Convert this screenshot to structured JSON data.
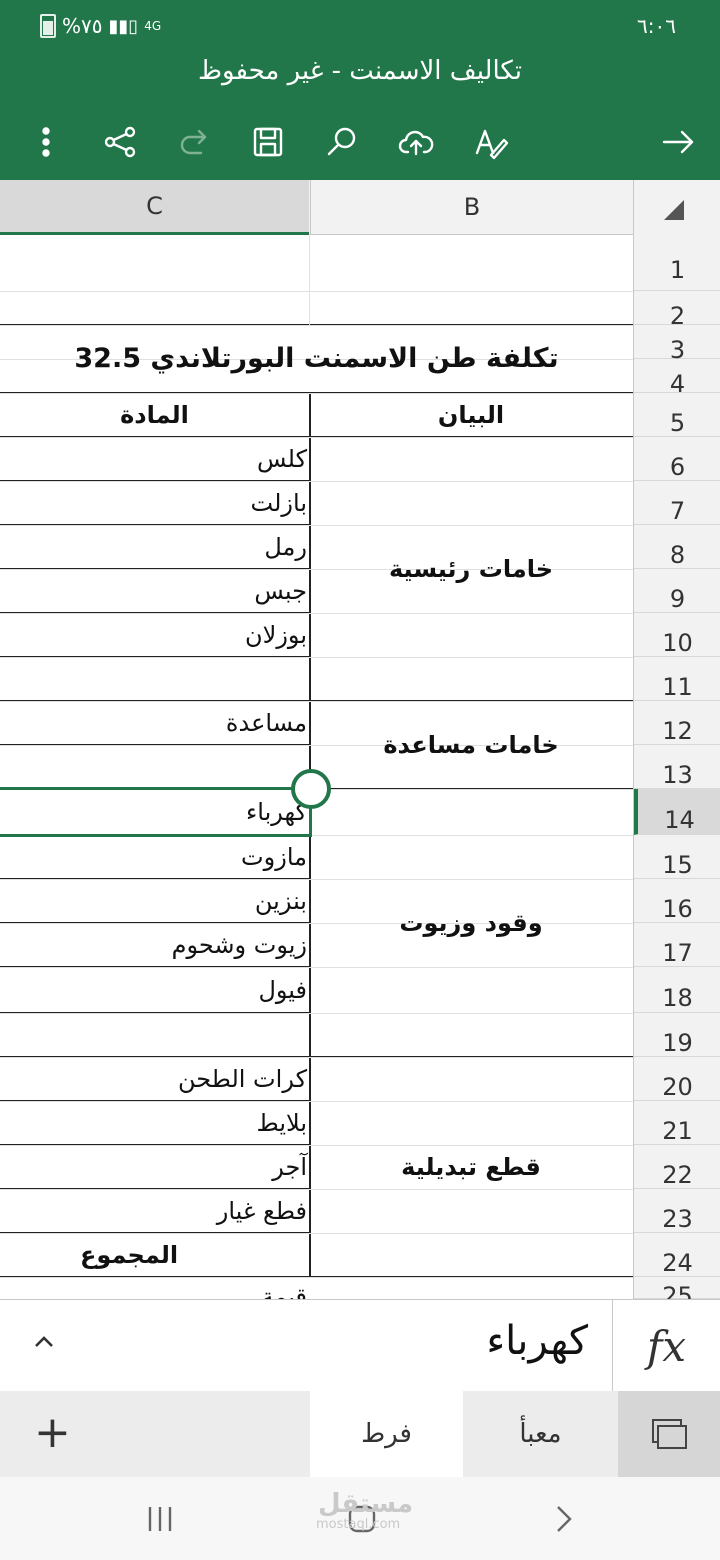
{
  "status": {
    "battery": "%٧٥",
    "network": "4G",
    "time": "٦:٠٦"
  },
  "title": "تكاليف الاسمنت - غير محفوظ",
  "toolbar": {
    "icons": [
      "more-icon",
      "share-icon",
      "redo-icon",
      "save-icon",
      "search-icon",
      "upload-icon",
      "edit-icon",
      "forward-arrow-icon"
    ]
  },
  "columns": {
    "c": "C",
    "b": "B"
  },
  "rows": [
    "1",
    "2",
    "3",
    "4",
    "5",
    "6",
    "7",
    "8",
    "9",
    "10",
    "11",
    "12",
    "13",
    "14",
    "15",
    "16",
    "17",
    "18",
    "19",
    "20",
    "21",
    "22",
    "23",
    "24",
    "25"
  ],
  "selected_row": "14",
  "sheet": {
    "title": "تكلفة طن الاسمنت البورتلاندي 32.5",
    "header_b": "البيان",
    "header_c": "المادة",
    "groups": [
      {
        "label": "خامات رئيسية",
        "items": [
          "كلس",
          "بازلت",
          "رمل",
          "جبس",
          "بوزلان"
        ]
      },
      {
        "label": "خامات مساعدة",
        "items": [
          "مساعدة"
        ]
      },
      {
        "label": "وقود وزيوت",
        "items": [
          "كهرباء",
          "مازوت",
          "بنزين",
          "زيوت وشحوم",
          "فيول"
        ]
      },
      {
        "label": "قطع تبديلية",
        "items": [
          "كرات الطحن",
          "بلايط",
          "آجر",
          "فطع غيار"
        ]
      }
    ],
    "total_label": "المجموع",
    "partial_row25": "قيمة ...."
  },
  "formula_bar": {
    "fx": "fx",
    "value": "كهرباء"
  },
  "sheet_tabs": [
    "فرط",
    "معبأ"
  ],
  "active_tab": "فرط",
  "watermark": {
    "ar": "مستقل",
    "en": "mostaql.com"
  },
  "colors": {
    "header": "#21774a",
    "selection": "#21774a"
  }
}
